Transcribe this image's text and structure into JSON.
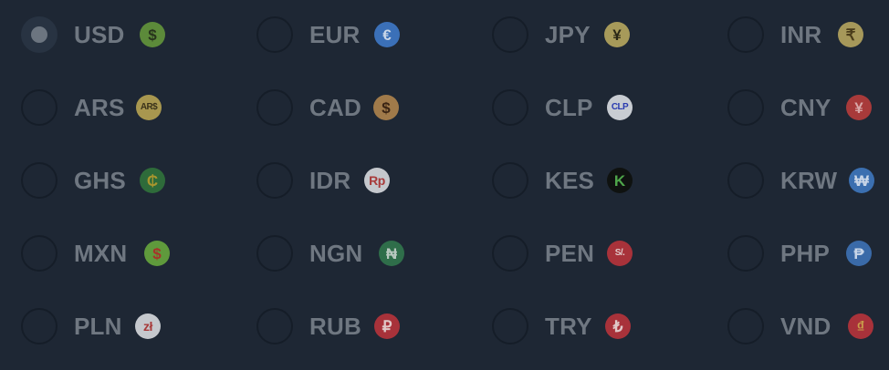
{
  "currency_selector": {
    "selected_code": "USD",
    "options": [
      {
        "code": "USD",
        "symbol": "$",
        "badge_bg": "#5c8a3a",
        "badge_fg": "#27341c",
        "selected": true
      },
      {
        "code": "EUR",
        "symbol": "€",
        "badge_bg": "#3b70b8",
        "badge_fg": "#c9d6e8",
        "selected": false
      },
      {
        "code": "JPY",
        "symbol": "¥",
        "badge_bg": "#a79a5a",
        "badge_fg": "#2a2716",
        "selected": false
      },
      {
        "code": "INR",
        "symbol": "₹",
        "badge_bg": "#a6985a",
        "badge_fg": "#4a3c1a",
        "selected": false
      },
      {
        "code": "ARS",
        "symbol": "AR$",
        "badge_bg": "#a8974f",
        "badge_fg": "#3a321a",
        "selected": false
      },
      {
        "code": "CAD",
        "symbol": "$",
        "badge_bg": "#a07a4a",
        "badge_fg": "#3a2414",
        "selected": false
      },
      {
        "code": "CLP",
        "symbol": "CLP",
        "badge_bg": "#c8ccd2",
        "badge_fg": "#2a3bb0",
        "selected": false
      },
      {
        "code": "CNY",
        "symbol": "¥",
        "badge_bg": "#a83a3a",
        "badge_fg": "#d8a7a7",
        "selected": false
      },
      {
        "code": "GHS",
        "symbol": "₵",
        "badge_bg": "#2e6b3a",
        "badge_fg": "#a8962e",
        "selected": false
      },
      {
        "code": "IDR",
        "symbol": "Rp",
        "badge_bg": "#c5c8cd",
        "badge_fg": "#a83a3a",
        "selected": false
      },
      {
        "code": "KES",
        "symbol": "K",
        "badge_bg": "#0f1210",
        "badge_fg": "#4ea54a",
        "selected": false
      },
      {
        "code": "KRW",
        "symbol": "₩",
        "badge_bg": "#3b6fb0",
        "badge_fg": "#c9d6e8",
        "selected": false
      },
      {
        "code": "MXN",
        "symbol": "$",
        "badge_bg": "#5f9a3c",
        "badge_fg": "#a8322a",
        "selected": false
      },
      {
        "code": "NGN",
        "symbol": "₦",
        "badge_bg": "#2f6e4a",
        "badge_fg": "#b8c8bf",
        "selected": false
      },
      {
        "code": "PEN",
        "symbol": "S/.",
        "badge_bg": "#a8323a",
        "badge_fg": "#e0c8c8",
        "selected": false
      },
      {
        "code": "PHP",
        "symbol": "₱",
        "badge_bg": "#3a6aa8",
        "badge_fg": "#c9d6e8",
        "selected": false
      },
      {
        "code": "PLN",
        "symbol": "zł",
        "badge_bg": "#c5c8cd",
        "badge_fg": "#a83a3a",
        "selected": false
      },
      {
        "code": "RUB",
        "symbol": "₽",
        "badge_bg": "#a8323a",
        "badge_fg": "#e0c8c8",
        "selected": false
      },
      {
        "code": "TRY",
        "symbol": "₺",
        "badge_bg": "#a8323a",
        "badge_fg": "#e0c8c8",
        "selected": false
      },
      {
        "code": "VND",
        "symbol": "₫",
        "badge_bg": "#a8323a",
        "badge_fg": "#c9a04a",
        "selected": false
      }
    ]
  }
}
